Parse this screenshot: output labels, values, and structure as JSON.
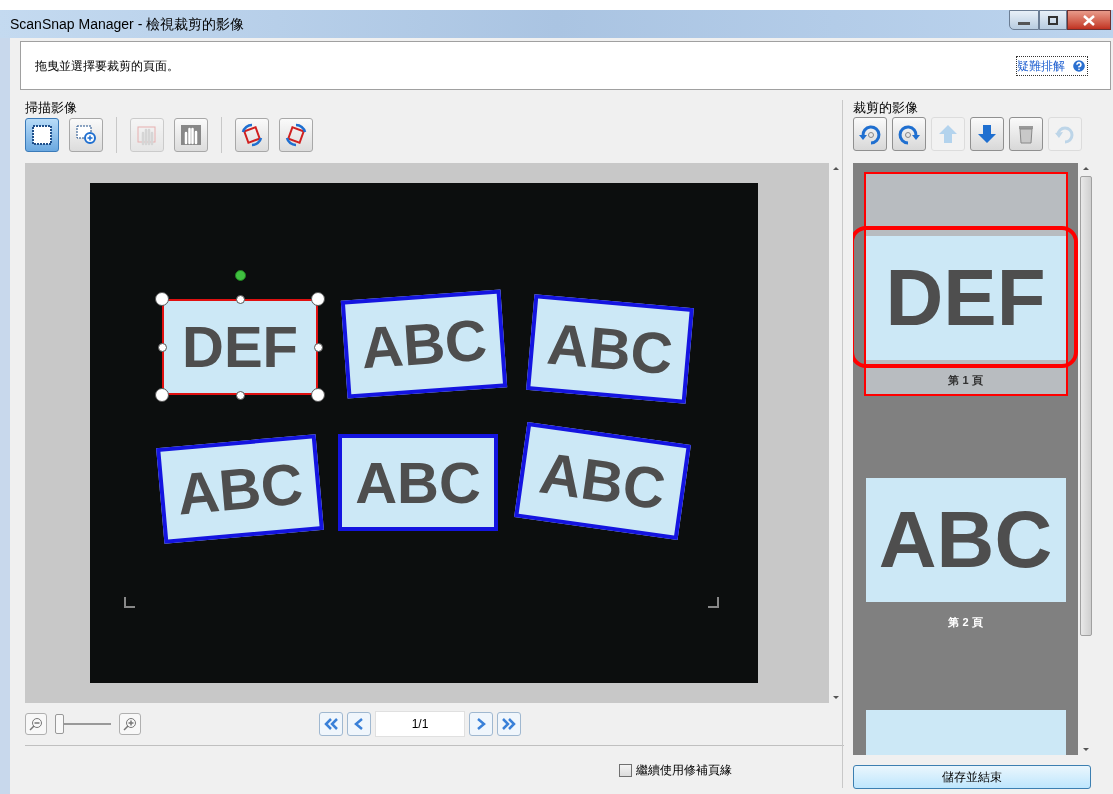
{
  "window": {
    "title": "ScanSnap Manager - 檢視裁剪的影像"
  },
  "instruction": "拖曳並選擇要裁剪的頁面。",
  "help_link": "疑難排解",
  "scan_panel": {
    "label": "掃描影像",
    "tools": [
      {
        "selected": true,
        "disabled": false
      },
      {
        "selected": false,
        "disabled": false
      },
      {
        "selected": false,
        "disabled": true
      },
      {
        "selected": false,
        "disabled": false
      },
      {
        "selected": false,
        "disabled": false
      },
      {
        "selected": false,
        "disabled": false
      }
    ],
    "cards": [
      {
        "text": "DEF",
        "selected": true
      },
      {
        "text": "ABC",
        "selected": false
      },
      {
        "text": "ABC",
        "selected": false
      },
      {
        "text": "ABC",
        "selected": false
      },
      {
        "text": "ABC",
        "selected": false
      },
      {
        "text": "ABC",
        "selected": false
      }
    ],
    "zoom": {
      "level": 0
    },
    "page": "1/1"
  },
  "cropped_panel": {
    "label": "裁剪的影像",
    "tools": [
      {
        "disabled": false
      },
      {
        "disabled": false
      },
      {
        "disabled": true
      },
      {
        "disabled": false
      },
      {
        "disabled": false
      },
      {
        "disabled": true
      }
    ],
    "thumbnails": [
      {
        "text": "DEF",
        "label": "第 1 頁",
        "selected": true
      },
      {
        "text": "ABC",
        "label": "第 2 頁",
        "selected": false
      },
      {
        "selected": false
      }
    ]
  },
  "keep_margin": {
    "label": "繼續使用修補頁緣",
    "checked": false
  },
  "save_button": "儲存並結束"
}
